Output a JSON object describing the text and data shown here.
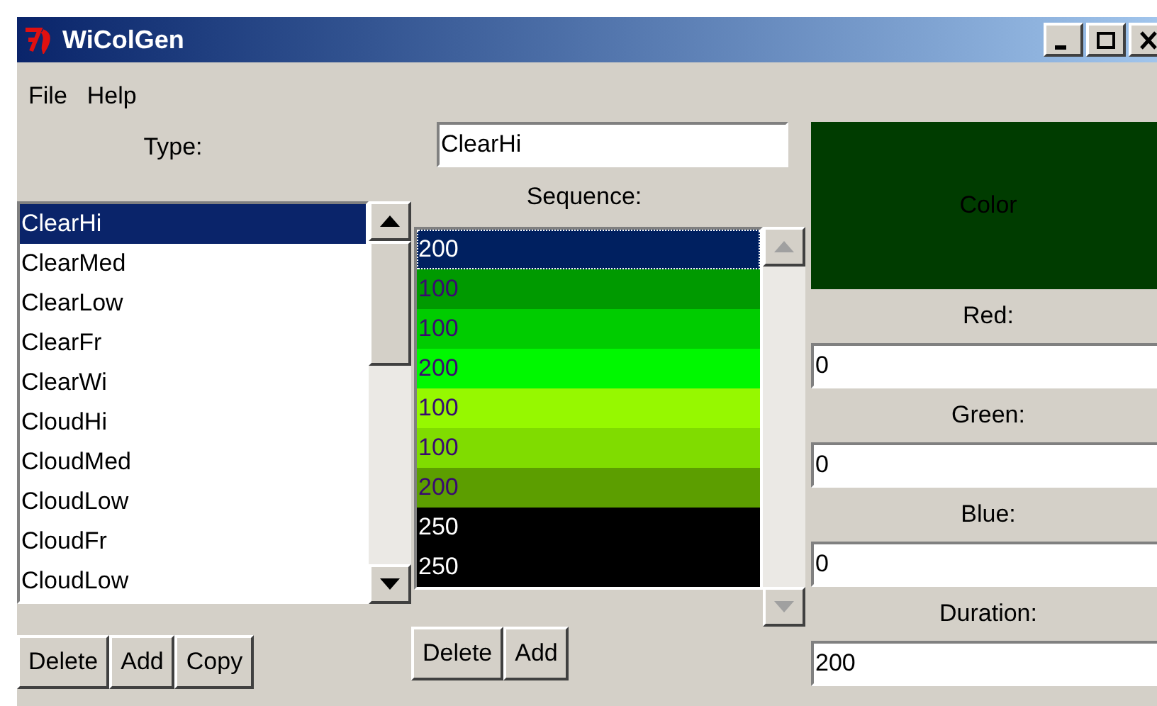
{
  "window": {
    "title": "WiColGen"
  },
  "menu": [
    "File",
    "Help"
  ],
  "type": {
    "label": "Type:",
    "value": "ClearHi",
    "items": [
      {
        "text": "ClearHi",
        "selected": true
      },
      {
        "text": "ClearMed",
        "selected": false
      },
      {
        "text": "ClearLow",
        "selected": false
      },
      {
        "text": "ClearFr",
        "selected": false
      },
      {
        "text": "ClearWi",
        "selected": false
      },
      {
        "text": "CloudHi",
        "selected": false
      },
      {
        "text": "CloudMed",
        "selected": false
      },
      {
        "text": "CloudLow",
        "selected": false
      },
      {
        "text": "CloudFr",
        "selected": false
      },
      {
        "text": "CloudLow",
        "selected": false
      }
    ],
    "buttons": [
      "Delete",
      "Add",
      "Copy"
    ]
  },
  "sequence": {
    "label": "Sequence:",
    "items": [
      {
        "text": "200",
        "selected": true,
        "color": "#002060"
      },
      {
        "text": "100",
        "selected": false,
        "color": "#009a00"
      },
      {
        "text": "100",
        "selected": false,
        "color": "#00cc00"
      },
      {
        "text": "200",
        "selected": false,
        "color": "#00f800"
      },
      {
        "text": "100",
        "selected": false,
        "color": "#96f800"
      },
      {
        "text": "100",
        "selected": false,
        "color": "#80dc00"
      },
      {
        "text": "200",
        "selected": false,
        "color": "#5c9e00"
      },
      {
        "text": "250",
        "selected": false,
        "color": "#000000"
      },
      {
        "text": "250",
        "selected": false,
        "color": "#000000"
      }
    ],
    "buttons": [
      "Delete",
      "Add"
    ]
  },
  "color_swatch": {
    "label": "Color",
    "color": "#003c00"
  },
  "fields": [
    {
      "label": "Red:",
      "value": "0"
    },
    {
      "label": "Green:",
      "value": "0"
    },
    {
      "label": "Blue:",
      "value": "0"
    },
    {
      "label": "Duration:",
      "value": "200"
    }
  ]
}
